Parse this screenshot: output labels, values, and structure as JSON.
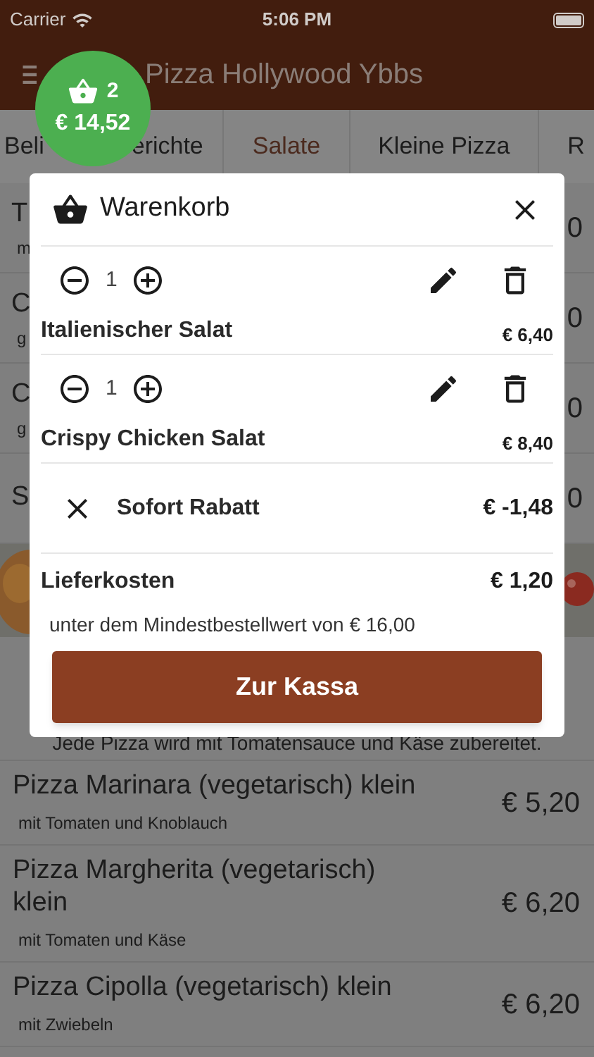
{
  "status_bar": {
    "carrier": "Carrier",
    "time": "5:06 PM"
  },
  "header": {
    "title": "Pizza Hollywood Ybbs"
  },
  "cart_badge": {
    "count": "2",
    "total": "€ 14,52"
  },
  "tabs": [
    {
      "label_parts": [
        "Beli",
        "erichte"
      ],
      "selected": false
    },
    {
      "label": "Salate",
      "selected": true
    },
    {
      "label": "Kleine Pizza",
      "selected": false
    },
    {
      "label": "R",
      "selected": false
    }
  ],
  "covered_rows": [
    {
      "title": "T",
      "subtitle": "m",
      "price": "0"
    },
    {
      "title": "C",
      "subtitle": "g",
      "price": "0"
    },
    {
      "title": "C",
      "subtitle": "g",
      "price": "0"
    },
    {
      "title": "S",
      "price": "0"
    }
  ],
  "section": {
    "description": "Jede Pizza wird mit Tomatensauce und Käse zubereitet."
  },
  "menu_items": [
    {
      "title": "Pizza Marinara (vegetarisch) klein",
      "subtitle": "mit Tomaten und Knoblauch",
      "price": "€ 5,20"
    },
    {
      "title": "Pizza Margherita (vegetarisch) klein",
      "subtitle": "mit Tomaten und Käse",
      "price": "€ 6,20"
    },
    {
      "title": "Pizza Cipolla (vegetarisch) klein",
      "subtitle": "mit Zwiebeln",
      "price": "€ 6,20"
    }
  ],
  "cart": {
    "title": "Warenkorb",
    "items": [
      {
        "quantity": "1",
        "name": "Italienischer Salat",
        "price": "€ 6,40"
      },
      {
        "quantity": "1",
        "name": "Crispy Chicken Salat",
        "price": "€ 8,40"
      }
    ],
    "discount": {
      "label": "Sofort Rabatt",
      "amount": "€ -1,48"
    },
    "delivery": {
      "label": "Lieferkosten",
      "price": "€ 1,20",
      "note": "unter dem Mindestbestellwert von € 16,00"
    },
    "checkout_button": "Zur Kassa"
  }
}
